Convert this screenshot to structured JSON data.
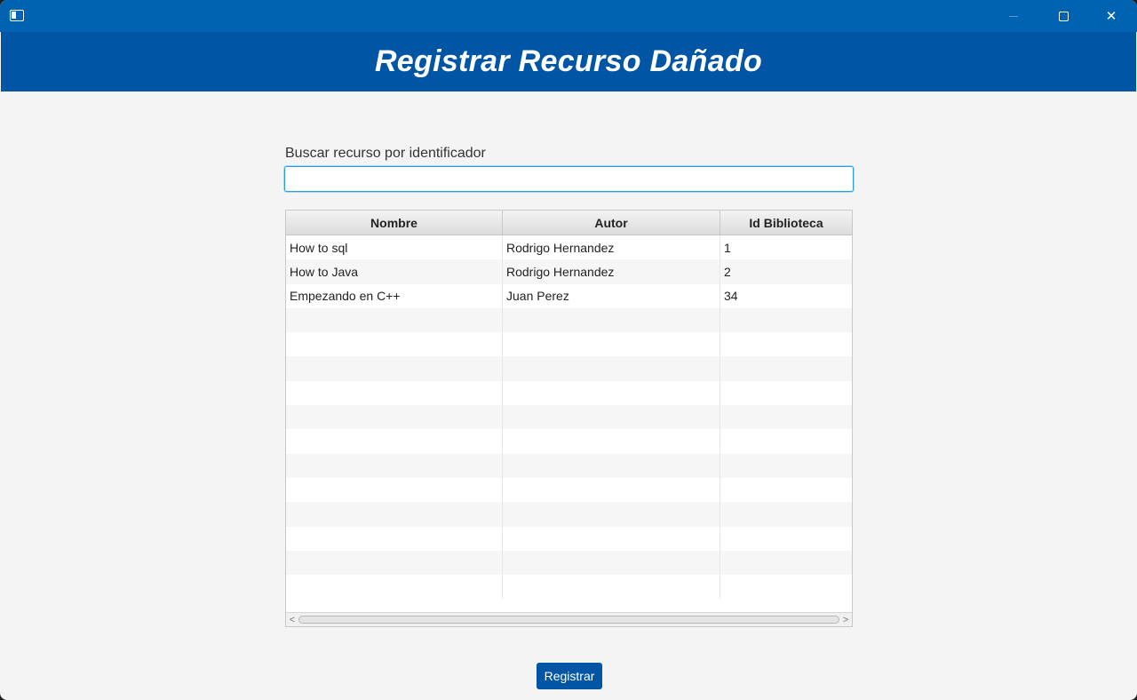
{
  "window": {
    "icons": {
      "app": "window-app-icon",
      "minimize": "minimize-icon",
      "maximize": "maximize-icon",
      "close": "close-icon"
    },
    "close_glyph": "✕"
  },
  "header": {
    "title": "Registrar Recurso Dañado"
  },
  "search": {
    "label": "Buscar recurso por identificador",
    "value": "",
    "placeholder": ""
  },
  "table": {
    "columns": [
      "Nombre",
      "Autor",
      "Id Biblioteca"
    ],
    "rows": [
      [
        "How to sql",
        "Rodrigo Hernandez",
        "1"
      ],
      [
        "How to Java",
        "Rodrigo Hernandez",
        "2"
      ],
      [
        "Empezando en C++",
        "Juan Perez",
        "34"
      ],
      [
        "",
        "",
        ""
      ],
      [
        "",
        "",
        ""
      ],
      [
        "",
        "",
        ""
      ],
      [
        "",
        "",
        ""
      ],
      [
        "",
        "",
        ""
      ],
      [
        "",
        "",
        ""
      ],
      [
        "",
        "",
        ""
      ],
      [
        "",
        "",
        ""
      ],
      [
        "",
        "",
        ""
      ],
      [
        "",
        "",
        ""
      ],
      [
        "",
        "",
        ""
      ],
      [
        "",
        "",
        ""
      ]
    ],
    "scroll_left_glyph": "<",
    "scroll_right_glyph": ">"
  },
  "actions": {
    "register_label": "Registrar"
  },
  "colors": {
    "titlebar": "#0063b1",
    "header": "#0055a5",
    "accent": "#2a9fd6",
    "button": "#0055a5"
  }
}
